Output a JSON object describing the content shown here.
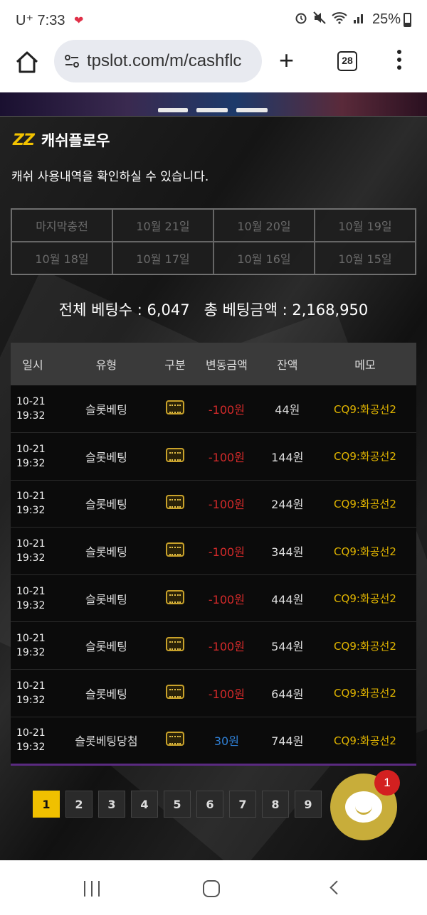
{
  "status": {
    "carrier": "U⁺ 7:33",
    "battery": "25%"
  },
  "browser": {
    "url": "tpslot.com/m/cashflc",
    "tab_count": "28"
  },
  "page": {
    "logo_text": "ZZ",
    "title": "캐쉬플로우",
    "subtitle": "캐쉬 사용내역을 확인하실 수 있습니다.",
    "date_tabs": [
      "마지막충전",
      "10월 21일",
      "10월 20일",
      "10월 19일",
      "10월 18일",
      "10월 17일",
      "10월 16일",
      "10월 15일"
    ],
    "totals": "전체 베팅수 : 6,047   총 베팅금액 : 2,168,950"
  },
  "table": {
    "headers": [
      "일시",
      "유형",
      "구분",
      "변동금액",
      "잔액",
      "메모"
    ],
    "rows": [
      {
        "date": "10-21",
        "time": "19:32",
        "type": "슬롯베팅",
        "amount": "-100원",
        "balance": "44원",
        "memo": "CQ9:화공선2"
      },
      {
        "date": "10-21",
        "time": "19:32",
        "type": "슬롯베팅",
        "amount": "-100원",
        "balance": "144원",
        "memo": "CQ9:화공선2"
      },
      {
        "date": "10-21",
        "time": "19:32",
        "type": "슬롯베팅",
        "amount": "-100원",
        "balance": "244원",
        "memo": "CQ9:화공선2"
      },
      {
        "date": "10-21",
        "time": "19:32",
        "type": "슬롯베팅",
        "amount": "-100원",
        "balance": "344원",
        "memo": "CQ9:화공선2"
      },
      {
        "date": "10-21",
        "time": "19:32",
        "type": "슬롯베팅",
        "amount": "-100원",
        "balance": "444원",
        "memo": "CQ9:화공선2"
      },
      {
        "date": "10-21",
        "time": "19:32",
        "type": "슬롯베팅",
        "amount": "-100원",
        "balance": "544원",
        "memo": "CQ9:화공선2"
      },
      {
        "date": "10-21",
        "time": "19:32",
        "type": "슬롯베팅",
        "amount": "-100원",
        "balance": "644원",
        "memo": "CQ9:화공선2"
      },
      {
        "date": "10-21",
        "time": "19:32",
        "type": "슬롯베팅당첨",
        "amount": "30원",
        "balance": "744원",
        "memo": "CQ9:화공선2"
      }
    ]
  },
  "pagination": {
    "pages": [
      "1",
      "2",
      "3",
      "4",
      "5",
      "6",
      "7",
      "8",
      "9"
    ],
    "active": "1"
  },
  "chat": {
    "badge": "1"
  },
  "colors": {
    "accent": "#f0c000",
    "negative": "#d42a2a",
    "positive": "#2f7fd4",
    "memo": "#e0b400"
  }
}
